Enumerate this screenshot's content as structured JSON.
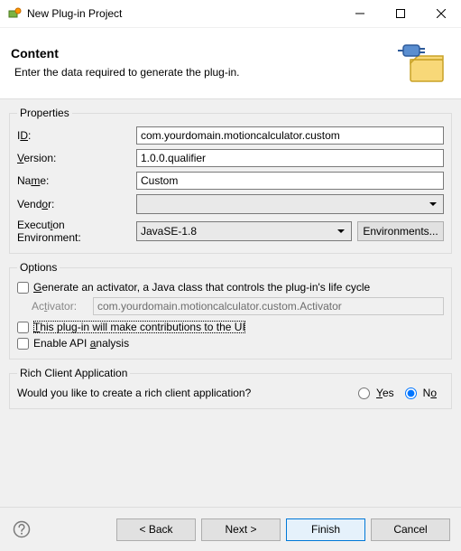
{
  "window": {
    "title": "New Plug-in Project"
  },
  "header": {
    "heading": "Content",
    "description": "Enter the data required to generate the plug-in."
  },
  "properties": {
    "legend": "Properties",
    "id_label": "ID:",
    "id_value": "com.yourdomain.motioncalculator.custom",
    "version_label": "Version:",
    "version_value": "1.0.0.qualifier",
    "name_label": "Name:",
    "name_value": "Custom",
    "vendor_label": "Vendor:",
    "vendor_value": "",
    "execenv_label": "Execution Environment:",
    "execenv_value": "JavaSE-1.8",
    "environments_btn": "Environments..."
  },
  "options": {
    "legend": "Options",
    "gen_activator_label": "Generate an activator, a Java class that controls the plug-in's life cycle",
    "gen_activator_label_ul": "G",
    "activator_label": "Activator:",
    "activator_value": "com.yourdomain.motioncalculator.custom.Activator",
    "contrib_ui_pre": "",
    "contrib_ui_label": "This plug-in will make contributions to the UI",
    "contrib_ui_ul": "T",
    "api_label": "Enable API analysis",
    "api_ul": "a"
  },
  "rcp": {
    "legend": "Rich Client Application",
    "question": "Would you like to create a rich client application?",
    "yes": "Yes",
    "no": "No"
  },
  "footer": {
    "back": "< Back",
    "next": "Next >",
    "finish": "Finish",
    "cancel": "Cancel"
  }
}
